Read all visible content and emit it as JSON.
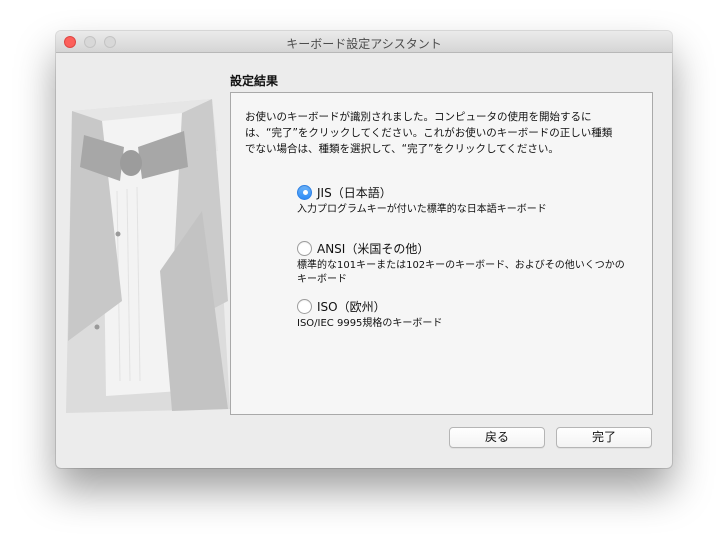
{
  "window": {
    "title": "キーボード設定アシスタント"
  },
  "main": {
    "heading": "設定結果",
    "intro_lines": [
      "お使いのキーボードが識別されました。コンピュータの使用を開始するに",
      "は、“完了”をクリックしてください。これがお使いのキーボードの正しい種類",
      "でない場合は、種類を選択して、“完了”をクリックしてください。"
    ],
    "options": [
      {
        "label": "JIS（日本語）",
        "description_lines": [
          "入力プログラムキーが付いた標準的な日本語キーボード"
        ],
        "selected": true
      },
      {
        "label": "ANSI（米国その他）",
        "description_lines": [
          "標準的な101キーまたは102キーのキーボード、およびその他いくつかの",
          "キーボード"
        ],
        "selected": false
      },
      {
        "label": "ISO（欧州）",
        "description_lines": [
          "ISO/IEC 9995規格のキーボード"
        ],
        "selected": false
      }
    ]
  },
  "buttons": {
    "back_label": "戻る",
    "done_label": "完了"
  },
  "colors": {
    "close_button": "#fc605b",
    "radio_selected": "#2f8cf6",
    "window_background": "#ececec"
  },
  "icons": {
    "illustration": "tuxedo-illustration"
  }
}
